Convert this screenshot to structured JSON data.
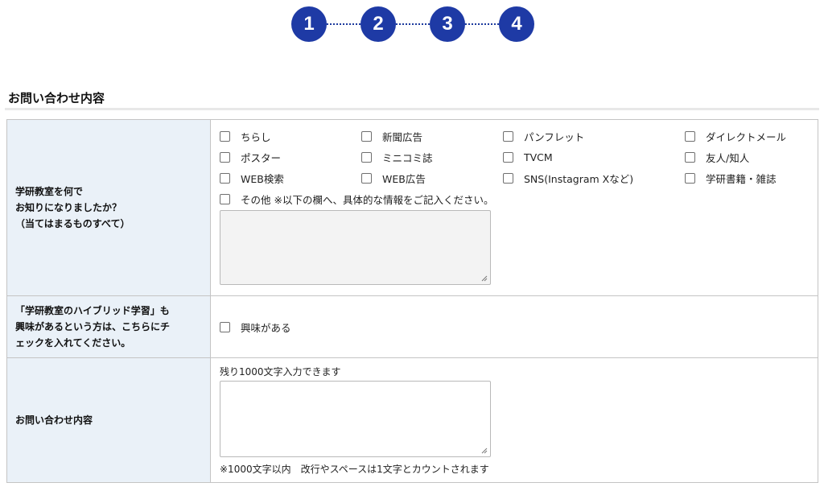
{
  "steps": [
    "1",
    "2",
    "3",
    "4"
  ],
  "section": {
    "title": "お問い合わせ内容"
  },
  "rows": {
    "source": {
      "label_lines": [
        "学研教室を何で",
        "お知りになりましたか？",
        "（当てはまるものすべて）"
      ],
      "options": [
        "ちらし",
        "新聞広告",
        "パンフレット",
        "ダイレクトメール",
        "ポスター",
        "ミニコミ誌",
        "TVCM",
        "友人/知人",
        "WEB検索",
        "WEB広告",
        "SNS(Instagram Xなど)",
        "学研書籍・雑誌"
      ],
      "other_label": "その他 ※以下の欄へ、具体的な情報をご記入ください。",
      "other_value": ""
    },
    "hybrid": {
      "label_lines": [
        "「学研教室のハイブリッド学習」も",
        "興味があるという方は、こちらにチ",
        "ェックを入れてください。"
      ],
      "option": "興味がある"
    },
    "inquiry": {
      "label": "お問い合わせ内容",
      "remaining": "残り1000文字入力できます",
      "value": "",
      "note": "※1000文字以内　改行やスペースは1文字とカウントされます"
    }
  }
}
